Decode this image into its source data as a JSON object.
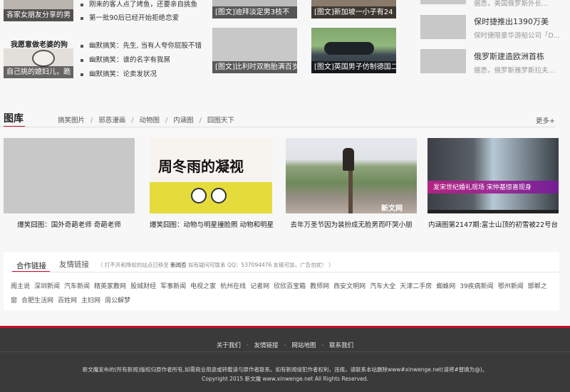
{
  "top_left": {
    "card1_caption": "吝家女朋友分享的男",
    "card2_title": "我愿意做老婆的狗",
    "card2_caption": "自己挑的媳妇儿，跪"
  },
  "joke_list": [
    "刚来的客人点了烤鱼，还要亲自挑鱼",
    "第一批90后已经开始拒绝恋爱",
    "幽默搞笑：先生, 当有人夸你屁股不错",
    "幽默搞笑：谁的名字有我屌",
    "幽默搞笑：论卖发状况"
  ],
  "image_news": [
    "[图文]迪拜淡定男3枝不",
    "[图文]新加坡一小子有24",
    "[图文]比利时双胞胎满百岁",
    "[图文]英国男子仿制德国二"
  ],
  "right_news": [
    {
      "title": "",
      "sub": "据悉，美国俄罗斯外长..."
    },
    {
      "title": "保时捷推出1390万美",
      "sub": "保时捷限豪华游船公司「D..."
    },
    {
      "title": "俄罗斯建造欧洲首栋",
      "sub": "据悉，俄罗斯雅罗斯拉夫..."
    }
  ],
  "gallery": {
    "title": "图库",
    "tabs": [
      "搞笑图片",
      "邪恶漫画",
      "动物图",
      "内涵图",
      "囧图天下"
    ],
    "more": "更多+",
    "items": [
      {
        "title": "爆笑囧图：国外奇葩老师 奇葩老师",
        "img_text": ""
      },
      {
        "title": "爆笑囧图：动物与明星撞脸照 动物和明星",
        "img_text": "周冬雨的凝视"
      },
      {
        "title": "去年万圣节因为装扮成无脸男而吓哭小朋",
        "img_text": "新文网"
      },
      {
        "title": "内涵图第2147期:富士山顶的初雪被22号台",
        "img_text": "发宋世纪婚礼现场 宋仲基惊喜现身"
      }
    ]
  },
  "links": {
    "tab_partner": "合作链接",
    "tab_friend": "友情链接",
    "note_prefix": "（ 打不开和降权的站点已移至 ",
    "note_site": "新闻否",
    "note_suffix": " 如有疑问可联系 QQ：537094476 友链可加，广告勿扰！ ）",
    "row1": [
      "阁主说",
      "深圳新闻",
      "汽车新闻",
      "精英家教网",
      "股城财经",
      "军事新闻",
      "电视之家",
      "杭州在线",
      "记者网",
      "欣欣百宝箱",
      "教师网",
      "西安文明网",
      "汽车大全",
      "天津二手房",
      "蜘蛛网",
      "39疾病新闻",
      "鄂州新闻",
      "邯郸之"
    ],
    "row2": [
      "窗",
      "合肥生活网",
      "百姓网",
      "主妇网",
      "周公解梦"
    ]
  },
  "footer": {
    "links": [
      "关于我们",
      "友情链接",
      "网站地图",
      "联系我们"
    ],
    "line1": "新文魔发布的(所有新闻)版权归原作者所有,如需商业用途或转载请与原作者联系。如有新闻侵犯作者权利，违规，请联系本站删除www#xinwenge.net(请将#替换为@)。",
    "line2": "Copyright 2015 新文魔 www.xinwenge.net All Rights Reserved."
  },
  "colors": {
    "accent": "#c8102e",
    "footer_bg": "#3a3a3a"
  }
}
